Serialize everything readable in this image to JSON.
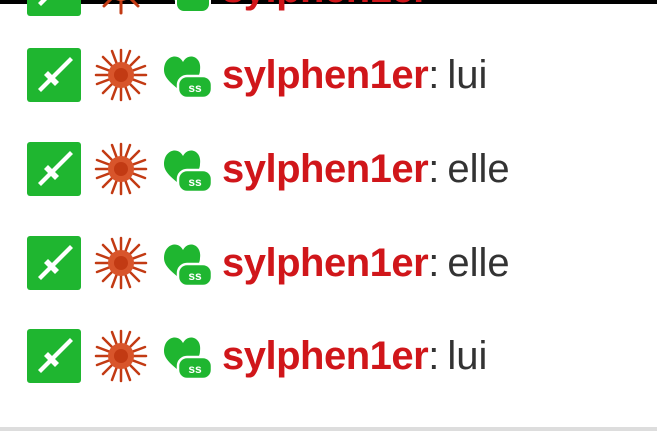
{
  "colors": {
    "username": "#d0161a",
    "message": "#333333",
    "badge_green": "#1fb630",
    "badge_red": "#c23a13"
  },
  "badges": [
    {
      "icon": "moderator-sword-icon"
    },
    {
      "icon": "subscriber-flower-icon"
    },
    {
      "icon": "ss-heart-icon"
    }
  ],
  "messages": [
    {
      "username": "sylphen1er",
      "separator": ":",
      "text": "lui"
    },
    {
      "username": "sylphen1er",
      "separator": ":",
      "text": "elle"
    },
    {
      "username": "sylphen1er",
      "separator": ":",
      "text": "elle"
    },
    {
      "username": "sylphen1er",
      "separator": ":",
      "text": "lui"
    }
  ]
}
